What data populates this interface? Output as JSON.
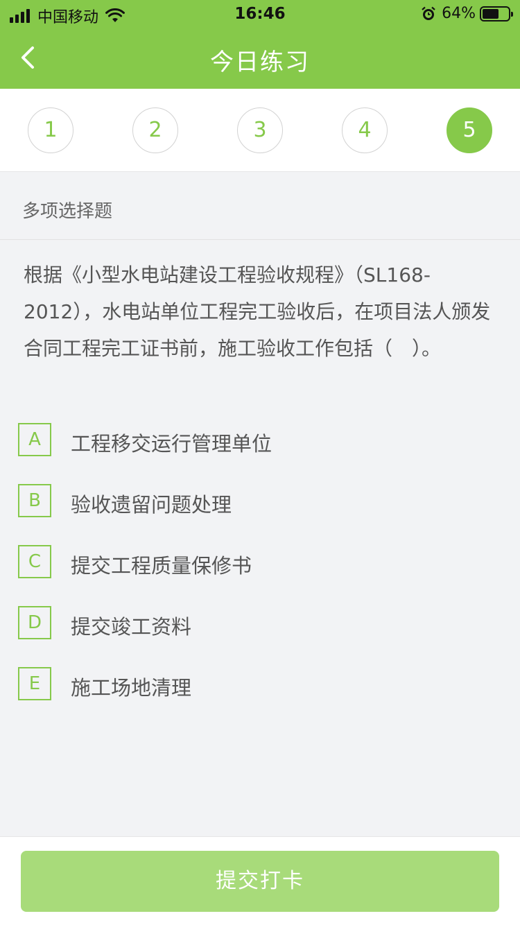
{
  "status_bar": {
    "carrier": "中国移动",
    "time": "16:46",
    "battery_percent": "64%",
    "battery_level": 0.64
  },
  "nav": {
    "title": "今日练习"
  },
  "steps": [
    {
      "label": "1",
      "active": false
    },
    {
      "label": "2",
      "active": false
    },
    {
      "label": "3",
      "active": false
    },
    {
      "label": "4",
      "active": false
    },
    {
      "label": "5",
      "active": true
    }
  ],
  "question": {
    "type": "多项选择题",
    "text": "根据《小型水电站建设工程验收规程》（SL168-2012），水电站单位工程完工验收后，在项目法人颁发合同工程完工证书前，施工验收工作包括（　）。",
    "options": [
      {
        "letter": "A",
        "text": "工程移交运行管理单位"
      },
      {
        "letter": "B",
        "text": "验收遗留问题处理"
      },
      {
        "letter": "C",
        "text": "提交工程质量保修书"
      },
      {
        "letter": "D",
        "text": "提交竣工资料"
      },
      {
        "letter": "E",
        "text": "施工场地清理"
      }
    ]
  },
  "footer": {
    "submit_label": "提交打卡"
  },
  "colors": {
    "accent": "#86c94a",
    "submit_disabled": "#a8db7a",
    "background": "#f2f3f5"
  }
}
